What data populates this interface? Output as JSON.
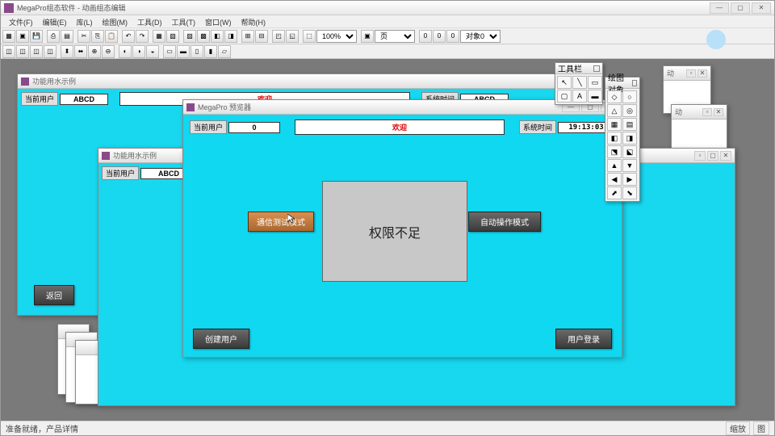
{
  "app": {
    "title": "MegaPro组态软件 - 动画组态编辑",
    "menu": [
      "文件(F)",
      "编辑(E)",
      "库(L)",
      "绘图(M)",
      "工具(D)",
      "工具(T)",
      "窗口(W)",
      "帮助(H)"
    ],
    "status_left": "准备就绪，产品详情",
    "status_right": [
      "缩放",
      "图"
    ]
  },
  "toolbar": {
    "zoom": "100%",
    "pagecombo": "页",
    "coords": [
      "0",
      "0",
      "0"
    ],
    "objcombo": "对象0"
  },
  "toolbox": {
    "title": "工具栏"
  },
  "toolbox2": {
    "title": "绘图对象"
  },
  "bg_window1": {
    "title": "功能用水示例",
    "user_label": "当前用户",
    "user_value": "ABCD",
    "welcome": "欢迎",
    "time_label": "系统时间",
    "time_value": "ABCD",
    "return_btn": "返回"
  },
  "bg_window2": {
    "title": "功能用水示例",
    "user_label": "当前用户",
    "user_value": "ABCD"
  },
  "preview": {
    "title": "MegaPro 预览器",
    "user_label": "当前用户",
    "user_value": "0",
    "welcome": "欢迎",
    "time_label": "系统时间",
    "time_value": "19:13:03",
    "btn_comm": "通信测试模式",
    "btn_auto": "自动操作模式",
    "modal_text": "权限不足",
    "btn_create": "创建用户",
    "btn_login": "用户登录"
  },
  "small_windows": {
    "w1": "动",
    "w2": "动"
  }
}
